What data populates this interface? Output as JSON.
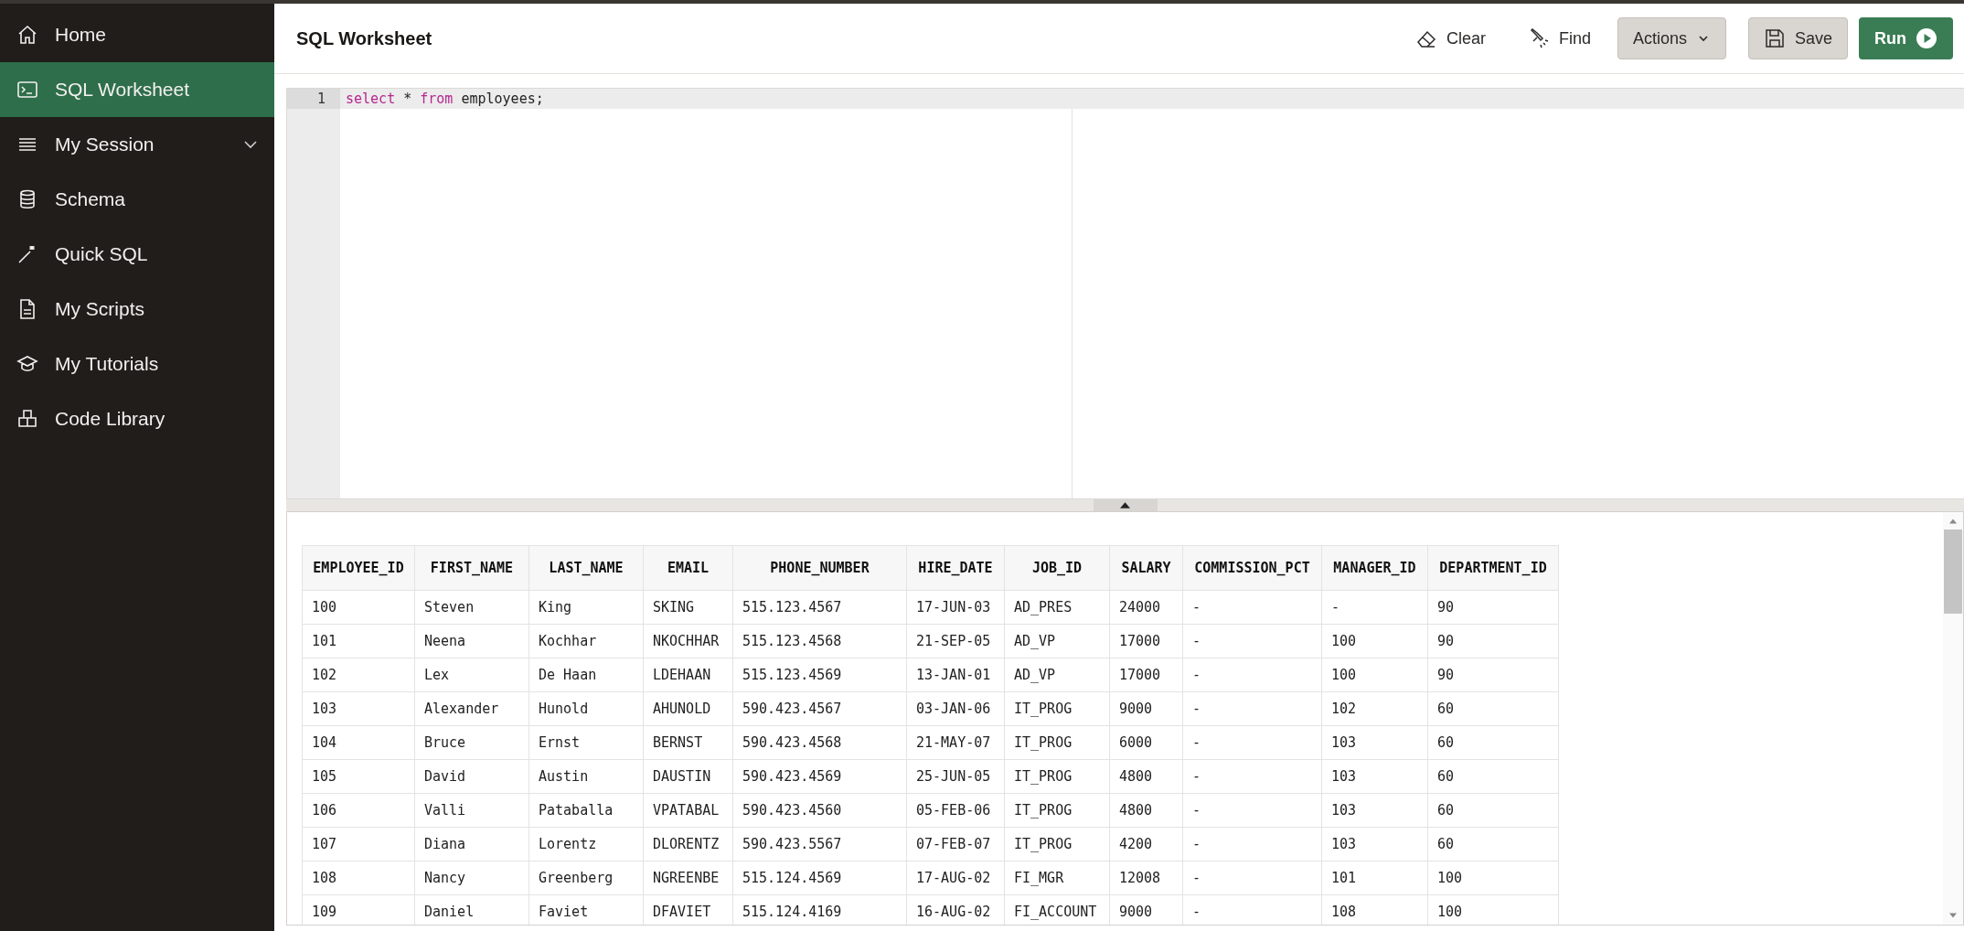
{
  "sidebar": {
    "items": [
      {
        "label": "Home",
        "kind": "link",
        "selected": false
      },
      {
        "label": "SQL Worksheet",
        "kind": "link",
        "selected": true
      },
      {
        "label": "My Session",
        "kind": "group",
        "selected": false
      },
      {
        "label": "Schema",
        "kind": "link",
        "selected": false
      },
      {
        "label": "Quick SQL",
        "kind": "link",
        "selected": false
      },
      {
        "label": "My Scripts",
        "kind": "link",
        "selected": false
      },
      {
        "label": "My Tutorials",
        "kind": "link",
        "selected": false
      },
      {
        "label": "Code Library",
        "kind": "link",
        "selected": false
      }
    ]
  },
  "header": {
    "title": "SQL Worksheet",
    "buttons": [
      {
        "label": "Clear",
        "kind": "plain"
      },
      {
        "label": "Find",
        "kind": "plain"
      },
      {
        "label": "Actions",
        "kind": "menu"
      },
      {
        "label": "Save",
        "kind": "secondary"
      },
      {
        "label": "Run",
        "kind": "primary"
      }
    ]
  },
  "editor": {
    "lines": [
      {
        "number": "1",
        "tokens": [
          {
            "text": "select",
            "kind": "keyword"
          },
          {
            "text": " * ",
            "kind": "plain"
          },
          {
            "text": "from",
            "kind": "keyword"
          },
          {
            "text": " employees;",
            "kind": "plain"
          }
        ]
      }
    ]
  },
  "results": {
    "columns": [
      "EMPLOYEE_ID",
      "FIRST_NAME",
      "LAST_NAME",
      "EMAIL",
      "PHONE_NUMBER",
      "HIRE_DATE",
      "JOB_ID",
      "SALARY",
      "COMMISSION_PCT",
      "MANAGER_ID",
      "DEPARTMENT_ID"
    ],
    "rows": [
      [
        "100",
        "Steven",
        "King",
        "SKING",
        "515.123.4567",
        "17-JUN-03",
        "AD_PRES",
        "24000",
        "-",
        "-",
        "90"
      ],
      [
        "101",
        "Neena",
        "Kochhar",
        "NKOCHHAR",
        "515.123.4568",
        "21-SEP-05",
        "AD_VP",
        "17000",
        "-",
        "100",
        "90"
      ],
      [
        "102",
        "Lex",
        "De Haan",
        "LDEHAAN",
        "515.123.4569",
        "13-JAN-01",
        "AD_VP",
        "17000",
        "-",
        "100",
        "90"
      ],
      [
        "103",
        "Alexander",
        "Hunold",
        "AHUNOLD",
        "590.423.4567",
        "03-JAN-06",
        "IT_PROG",
        "9000",
        "-",
        "102",
        "60"
      ],
      [
        "104",
        "Bruce",
        "Ernst",
        "BERNST",
        "590.423.4568",
        "21-MAY-07",
        "IT_PROG",
        "6000",
        "-",
        "103",
        "60"
      ],
      [
        "105",
        "David",
        "Austin",
        "DAUSTIN",
        "590.423.4569",
        "25-JUN-05",
        "IT_PROG",
        "4800",
        "-",
        "103",
        "60"
      ],
      [
        "106",
        "Valli",
        "Pataballa",
        "VPATABAL",
        "590.423.4560",
        "05-FEB-06",
        "IT_PROG",
        "4800",
        "-",
        "103",
        "60"
      ],
      [
        "107",
        "Diana",
        "Lorentz",
        "DLORENTZ",
        "590.423.5567",
        "07-FEB-07",
        "IT_PROG",
        "4200",
        "-",
        "103",
        "60"
      ],
      [
        "108",
        "Nancy",
        "Greenberg",
        "NGREENBE",
        "515.124.4569",
        "17-AUG-02",
        "FI_MGR",
        "12008",
        "-",
        "101",
        "100"
      ],
      [
        "109",
        "Daniel",
        "Faviet",
        "DFAVIET",
        "515.124.4169",
        "16-AUG-02",
        "FI_ACCOUNT",
        "9000",
        "-",
        "108",
        "100"
      ]
    ]
  }
}
